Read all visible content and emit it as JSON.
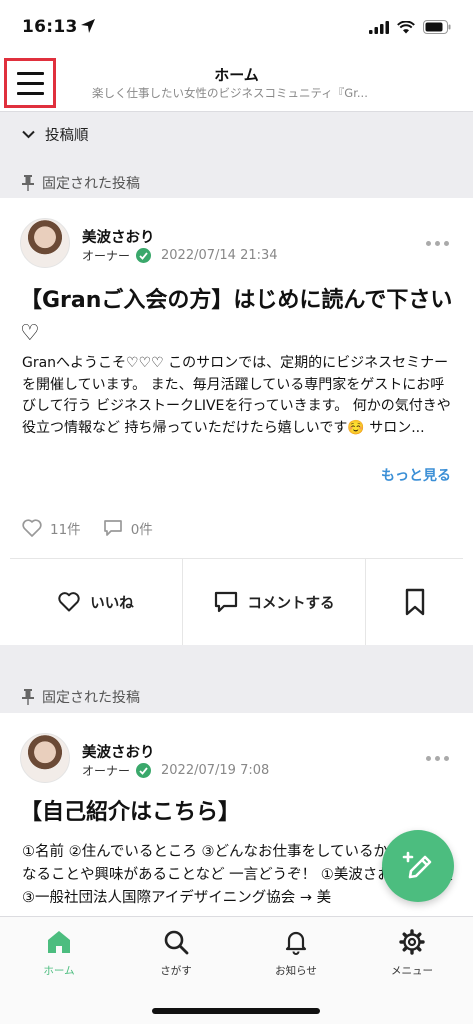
{
  "status_bar": {
    "time": "16:13"
  },
  "header": {
    "title": "ホーム",
    "subtitle": "楽しく仕事したい女性のビジネスコミュニティ『Gr..."
  },
  "sort": {
    "label": "投稿順"
  },
  "posts": [
    {
      "pinned_label": "固定された投稿",
      "author": "美波さおり",
      "role": "オーナー",
      "date": "2022/07/14 21:34",
      "title": "【Granご入会の方】はじめに読んで下さい♡",
      "body": "Granへようこそ♡♡♡ このサロンでは、定期的にビジネスセミナーを開催しています。 また、毎月活躍している専門家をゲストにお呼びして行う ビジネストークLIVEを行っていきます。 何かの気付きや役立つ情報など 持ち帰っていただけたら嬉しいです☺️ サロン...",
      "see_more": "もっと見る",
      "likes": "11件",
      "comments": "0件",
      "like_label": "いいね",
      "comment_label": "コメントする"
    },
    {
      "pinned_label": "固定された投稿",
      "author": "美波さおり",
      "role": "オーナー",
      "date": "2022/07/19 7:08",
      "title": "【自己紹介はこちら】",
      "body": "①名前 ②住んでいるところ ③どんなお仕事をしているか ④今気になることや興味があることなど 一言どうぞ！ ①美波さおり ②大阪 ③一般社団法人国際アイデザイニング協会 → 美"
    }
  ],
  "tabs": [
    {
      "label": "ホーム",
      "icon": "home-icon",
      "active": true
    },
    {
      "label": "さがす",
      "icon": "search-icon",
      "active": false
    },
    {
      "label": "お知らせ",
      "icon": "bell-icon",
      "active": false
    },
    {
      "label": "メニュー",
      "icon": "gear-icon",
      "active": false
    }
  ],
  "colors": {
    "accent": "#4cbd7f",
    "link": "#3b8fd6",
    "highlight": "#e0303d",
    "verified": "#3aa86b"
  }
}
